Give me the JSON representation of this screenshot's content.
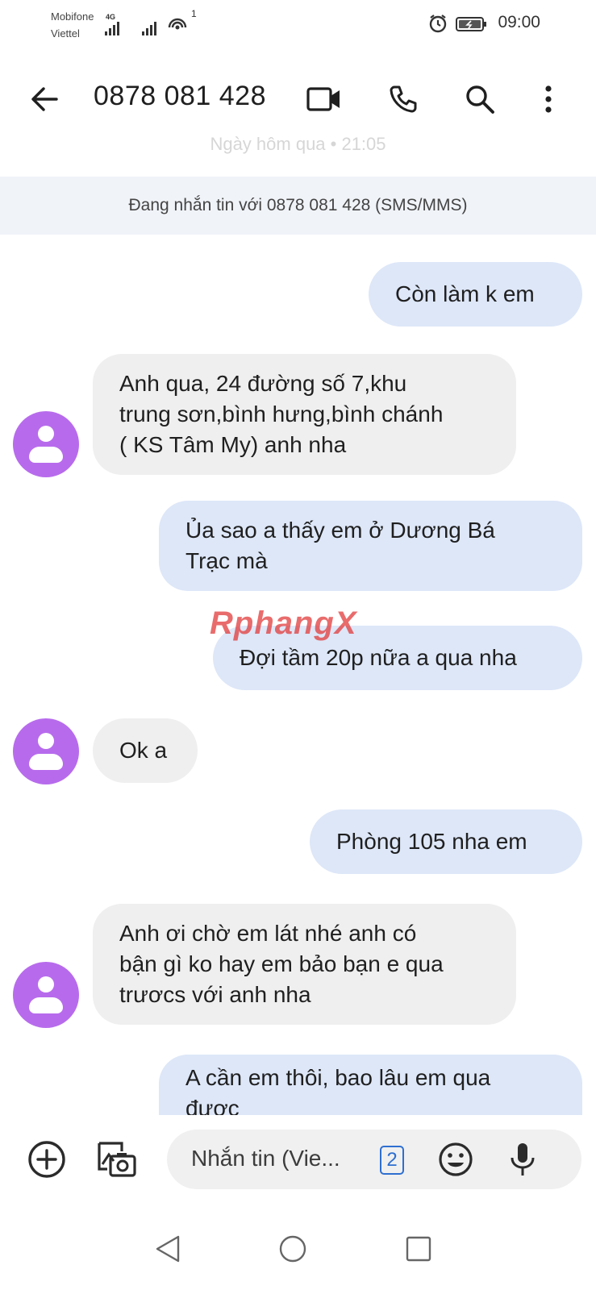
{
  "status_bar": {
    "carrier1": "Mobifone",
    "carrier2": "Viettel",
    "network_tag": "4G",
    "hotspot_count": "1",
    "time": "09:00"
  },
  "header": {
    "title": "0878 081 428",
    "back_icon": "arrow-back-icon",
    "video_icon": "video-call-icon",
    "phone_icon": "phone-icon",
    "search_icon": "search-icon",
    "more_icon": "more-vert-icon"
  },
  "conversation": {
    "date_divider": "Ngày hôm qua • 21:05",
    "info_banner": "Đang nhắn tin với 0878 081 428 (SMS/MMS)",
    "watermark_part1": "Rphang",
    "watermark_part2": "X",
    "messages": [
      {
        "direction": "outgoing",
        "lines": [
          "Còn làm k em"
        ]
      },
      {
        "direction": "incoming",
        "lines": [
          "Anh qua, 24 đường số 7,khu",
          "trung sơn,bình hưng,bình chánh",
          "( KS Tâm My) anh nha"
        ]
      },
      {
        "direction": "outgoing",
        "lines": [
          "Ủa sao a thấy em ở Dương Bá",
          "Trạc mà"
        ]
      },
      {
        "direction": "outgoing",
        "lines": [
          "Đợi tầm 20p nữa a qua nha"
        ]
      },
      {
        "direction": "incoming",
        "lines": [
          "Ok a"
        ]
      },
      {
        "direction": "outgoing",
        "lines": [
          "Phòng 105 nha em"
        ]
      },
      {
        "direction": "incoming",
        "lines": [
          "Anh ơi chờ em lát nhé anh có",
          "bận gì ko hay em bảo bạn e qua",
          "trươcs với anh nha"
        ]
      },
      {
        "direction": "outgoing",
        "lines": [
          "A cần em thôi, bao lâu em qua",
          "được"
        ]
      }
    ]
  },
  "composer": {
    "placeholder": "Nhắn tin (Vie...",
    "sim_number": "2",
    "add_icon": "add-circle-icon",
    "gallery_icon": "photo-camera-icon",
    "emoji_icon": "emoji-icon",
    "mic_icon": "microphone-icon"
  },
  "nav": {
    "back": "nav-back-icon",
    "home": "nav-home-icon",
    "recents": "nav-recents-icon"
  },
  "colors": {
    "outgoing_bubble": "#dde7f8",
    "incoming_bubble": "#efefef",
    "avatar": "#b76bec",
    "banner": "#f0f3f8",
    "sim_badge": "#2e6fd0"
  }
}
